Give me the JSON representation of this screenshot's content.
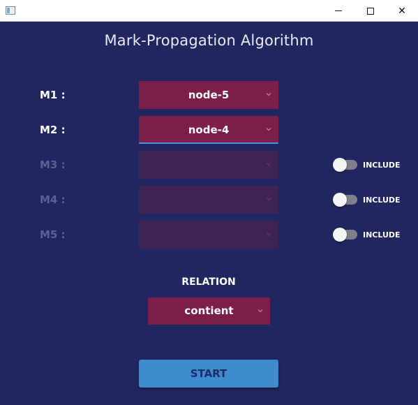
{
  "window": {
    "minimize_glyph": "minimize-icon",
    "maximize_glyph": "maximize-icon",
    "close_glyph": "✕"
  },
  "app": {
    "title": "Mark-Propagation Algorithm"
  },
  "marks": [
    {
      "label": "M1 :",
      "value": "node-5",
      "enabled": true
    },
    {
      "label": "M2 :",
      "value": "node-4",
      "enabled": true,
      "focused": true
    },
    {
      "label": "M3 :",
      "value": "",
      "enabled": false,
      "include_label": "INCLUDE",
      "include_on": false
    },
    {
      "label": "M4 :",
      "value": "",
      "enabled": false,
      "include_label": "INCLUDE",
      "include_on": false
    },
    {
      "label": "M5 :",
      "value": "",
      "enabled": false,
      "include_label": "INCLUDE",
      "include_on": false
    }
  ],
  "relation": {
    "heading": "RELATION",
    "value": "contient"
  },
  "actions": {
    "start_label": "START"
  },
  "colors": {
    "background": "#1f2660",
    "combo_active": "#7b1e48",
    "combo_disabled": "#3e2455",
    "start_button": "#3e8ccd",
    "start_text": "#1f2a6a",
    "focus_underline": "#4f8fd6"
  }
}
